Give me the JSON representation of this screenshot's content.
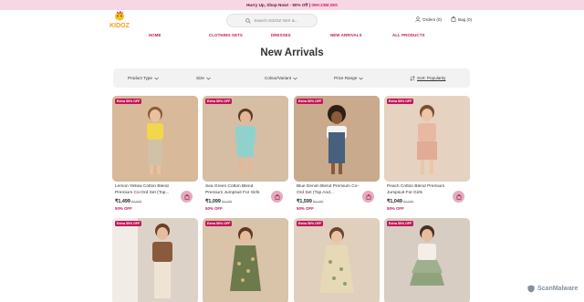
{
  "promo": {
    "text": "Hurry Up, Shop Now! - 50% Off",
    "separator": " | ",
    "timer": "00H:23M:28S"
  },
  "header": {
    "logo_text": "KIDOZ",
    "search_placeholder": "Search KIDOZ NIVI &...",
    "orders_label": "Orders (0)",
    "bag_label": "Bag (0)"
  },
  "nav": {
    "items": [
      "HOME",
      "CLOTHING SETS",
      "DRESSES",
      "NEW ARRIVALS",
      "ALL PRODUCTS"
    ]
  },
  "page": {
    "title": "New Arrivals"
  },
  "filters": {
    "product_type": "Product Type",
    "size": "Size",
    "colour": "Colour/Variant",
    "price": "Price Range",
    "sort": "Sort: Popularity"
  },
  "products": [
    {
      "badge": "Extra 50% OFF",
      "name": "Lemon Yellow Cotton Blend Premium Co-Ord Set (Top...",
      "price": "₹1,499",
      "mrp": "₹2,999",
      "discount": "50% OFF"
    },
    {
      "badge": "Extra 50% OFF",
      "name": "Sea Green Cotton Blend Premium Jumpsuit For Girls",
      "price": "₹1,099",
      "mrp": "₹2,199",
      "discount": "50% OFF"
    },
    {
      "badge": "Extra 50% OFF",
      "name": "Blue Denim Blend Premium Co-Ord Set (Top And...",
      "price": "₹1,599",
      "mrp": "₹3,199",
      "discount": "50% OFF"
    },
    {
      "badge": "Extra 50% OFF",
      "name": "Peach Cotton Blend Premium Jumpsuit For Girls",
      "price": "₹1,049",
      "mrp": "₹2,099",
      "discount": "50% OFF"
    },
    {
      "badge": "Extra 50% OFF"
    },
    {
      "badge": "Extra 50% OFF"
    },
    {
      "badge": "Extra 50% OFF"
    },
    {
      "badge": "Extra 50% OFF"
    }
  ],
  "watermark": {
    "text": "ScanMalware"
  },
  "colors": {
    "accent": "#c2185b",
    "promo_bg": "#f7d7e3",
    "filter_bg": "#f2f2f2"
  }
}
